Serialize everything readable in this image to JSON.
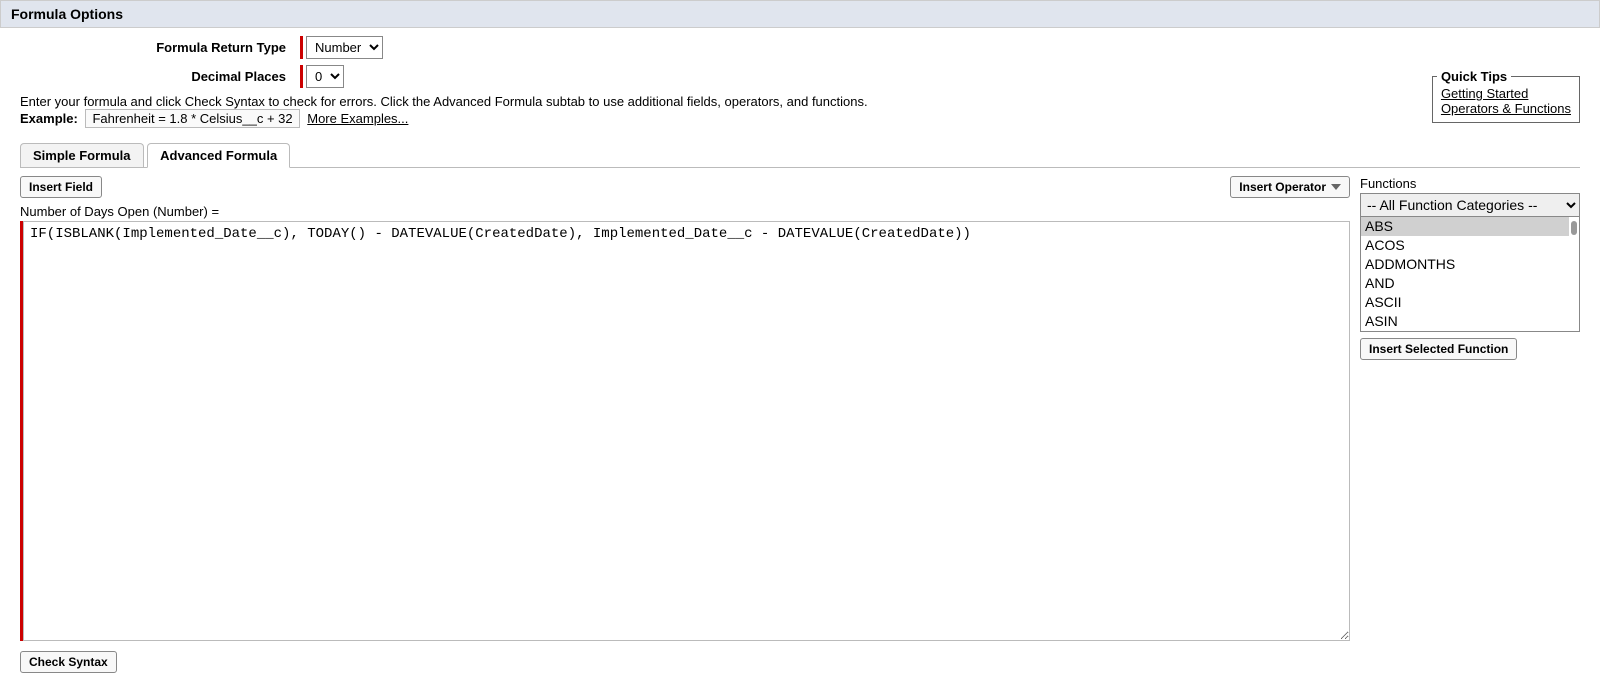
{
  "header": {
    "title": "Formula Options"
  },
  "fields": {
    "return_type_label": "Formula Return Type",
    "return_type_value": "Number",
    "decimal_places_label": "Decimal Places",
    "decimal_places_value": "0"
  },
  "instr": {
    "line1": "Enter your formula and click Check Syntax to check for errors. Click the Advanced Formula subtab to use additional fields, operators, and functions.",
    "example_label": "Example:",
    "example_pill": "Fahrenheit = 1.8 * Celsius__c + 32",
    "more_examples": "More Examples..."
  },
  "quick_tips": {
    "legend": "Quick Tips",
    "link1": "Getting Started",
    "link2": "Operators & Functions"
  },
  "tabs": {
    "simple": "Simple Formula",
    "advanced": "Advanced Formula"
  },
  "toolbar": {
    "insert_field": "Insert Field",
    "insert_operator": "Insert Operator"
  },
  "editor": {
    "field_label": "Number of Days Open (Number) =",
    "formula": "IF(ISBLANK(Implemented_Date__c), TODAY() - DATEVALUE(CreatedDate), Implemented_Date__c - DATEVALUE(CreatedDate))"
  },
  "functions": {
    "panel_label": "Functions",
    "category_value": "-- All Function Categories --",
    "list": [
      "ABS",
      "ACOS",
      "ADDMONTHS",
      "AND",
      "ASCII",
      "ASIN"
    ],
    "selected_index": 0,
    "insert_button": "Insert Selected Function"
  },
  "footer": {
    "check_syntax": "Check Syntax"
  }
}
